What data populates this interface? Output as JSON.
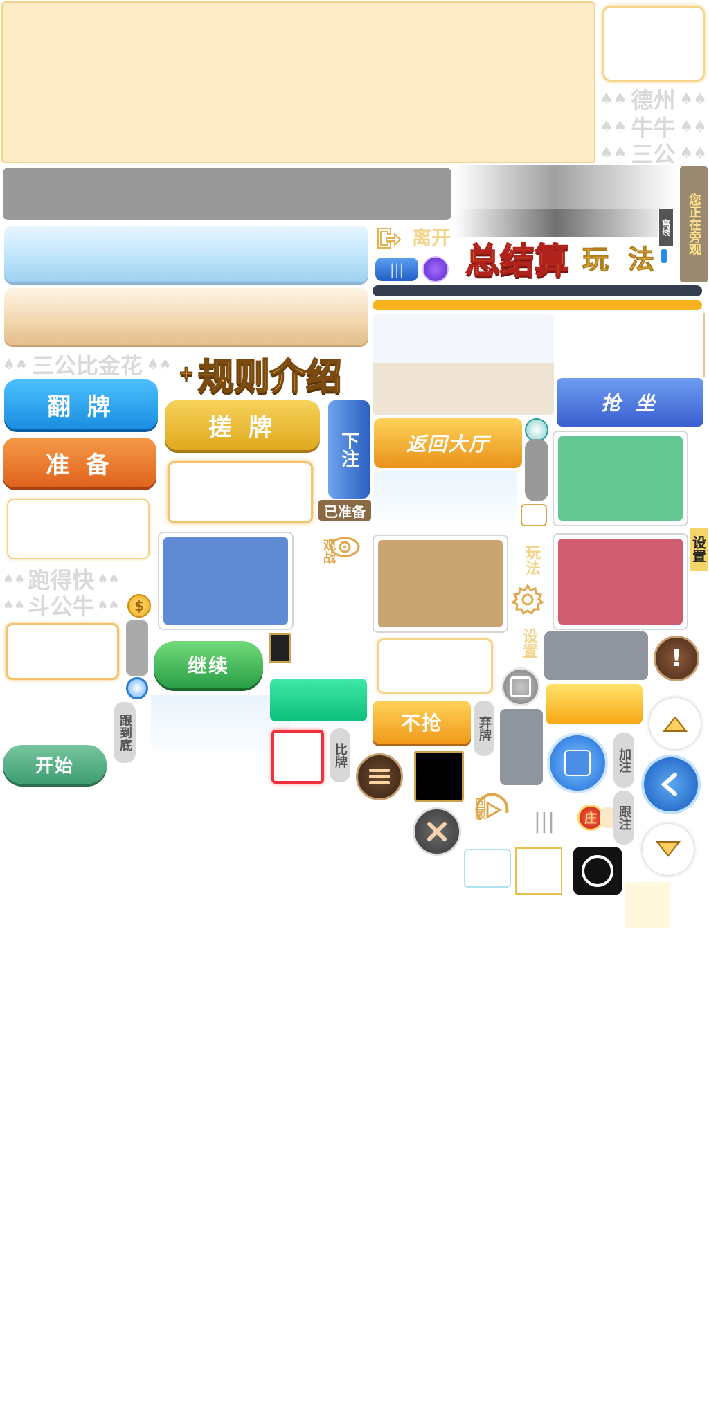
{
  "labels": {
    "dezhou": "德州",
    "niuniu": "牛牛",
    "sangong": "三公",
    "watching": "您正在旁观",
    "offline": "离线",
    "leave": "离开",
    "summary": "总结算",
    "play_a": "玩",
    "play_b": "法",
    "sangong_jinhua": "三公比金花",
    "rules_intro": "规则介绍",
    "flip": "翻 牌",
    "rub": "搓 牌",
    "bet": "下注",
    "ready_btn": "准 备",
    "ready_tag": "已准备",
    "grab_seat": "抢 坐",
    "back_lobby": "返回大厅",
    "spectate": "观战",
    "paodekuai": "跑得快",
    "douniuniu": "斗公牛",
    "gameplay": "玩法",
    "settings_v": "设置",
    "settings_r": "设置",
    "continue": "继续",
    "follow_end": "跟到底",
    "start": "开始",
    "no_grab": "不抢",
    "fold": "弃牌",
    "compare": "比牌",
    "raise": "加注",
    "call": "跟注",
    "review": "回顾",
    "banker": "庄"
  },
  "colors": {
    "panel_cream": "#fdecc6",
    "panel_border": "#f3d48a",
    "gray_bar": "#999999",
    "dark_bar": "#343e4f",
    "orange_bar": "#f7b21d",
    "blue_btn": "#1a8de0",
    "orange_btn": "#e56a22",
    "gold_btn": "#e8b42b",
    "green_btn": "#2fae5a",
    "teal_btn": "#50a07e",
    "card_blue": "#5f8bd4",
    "card_green": "#62c793",
    "card_red": "#d05e70",
    "card_tan": "#c9a572"
  },
  "icons": {
    "exit": "exit-icon",
    "dollar": "dollar-coin-icon",
    "eye": "eye-icon",
    "gear": "gear-icon",
    "menu": "menu-icon",
    "close": "close-icon",
    "alert": "alert-icon",
    "up": "arrow-up-icon",
    "down": "arrow-down-icon",
    "back": "back-icon"
  }
}
